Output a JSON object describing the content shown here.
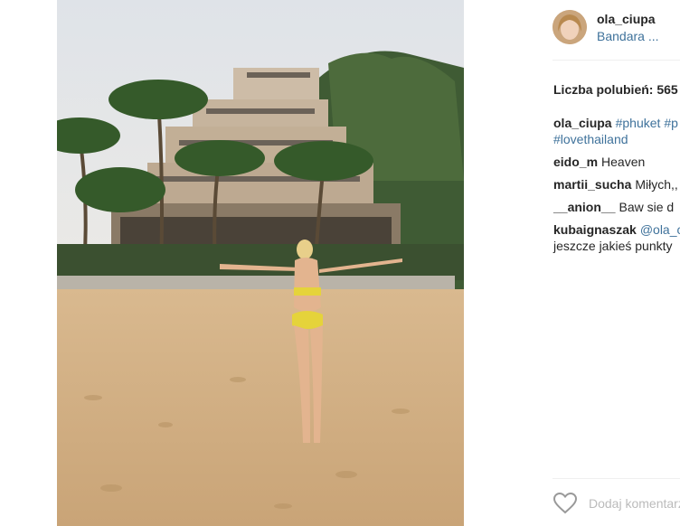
{
  "post": {
    "username": "ola_ciupa",
    "location": "Bandara ...",
    "likes_text": "Liczba polubień: 565",
    "caption": {
      "user": "ola_ciupa",
      "tag1": "#phuket",
      "tag1_tail": "#p",
      "tag2": "#lovethailand"
    },
    "comments": [
      {
        "user": "eido_m",
        "text": "Heaven"
      },
      {
        "user": "martii_sucha",
        "text": "Miłych,,"
      },
      {
        "user": "__anion__",
        "text": "Baw sie d"
      },
      {
        "user": "kubaignaszak",
        "mention": "@ola_c",
        "text2": "jeszcze jakieś punkty"
      }
    ],
    "add_comment_placeholder": "Dodaj komentarz",
    "icons": {
      "like": "heart-icon"
    },
    "colors": {
      "link": "#3f729b",
      "text": "#262626",
      "muted": "#bbbbbb"
    }
  }
}
